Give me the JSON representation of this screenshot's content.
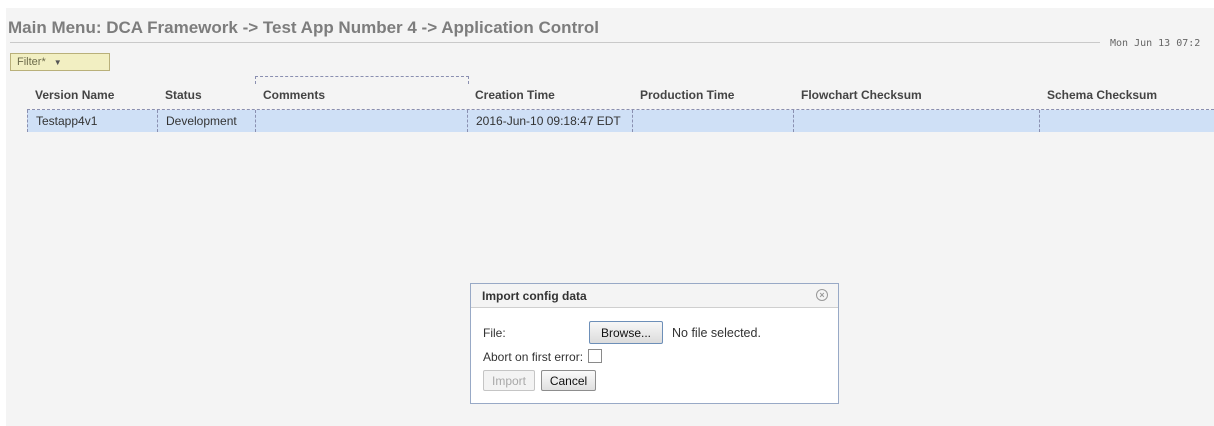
{
  "header": {
    "title": "Main Menu: DCA Framework -> Test App Number 4 -> Application Control",
    "datetime": "Mon Jun 13 07:2"
  },
  "toolbar": {
    "filter_label": "Filter*",
    "filter_caret": "▼"
  },
  "table": {
    "columns": [
      "Version Name",
      "Status",
      "Comments",
      "Creation Time",
      "Production Time",
      "Flowchart Checksum",
      "Schema Checksum"
    ],
    "rows": [
      [
        "Testapp4v1",
        "Development",
        "",
        "2016-Jun-10 09:18:47 EDT",
        "",
        "",
        ""
      ]
    ]
  },
  "dialog": {
    "title": "Import config data",
    "close_glyph": "×",
    "file_label": "File:",
    "browse_label": "Browse...",
    "file_status": "No file selected.",
    "abort_label": "Abort on first error:",
    "abort_checked": false,
    "import_label": "Import",
    "cancel_label": "Cancel"
  },
  "colors": {
    "selected_row": "#cfe0f6",
    "filter_bg": "#f2efc2",
    "title_text": "#7d7d7d"
  }
}
